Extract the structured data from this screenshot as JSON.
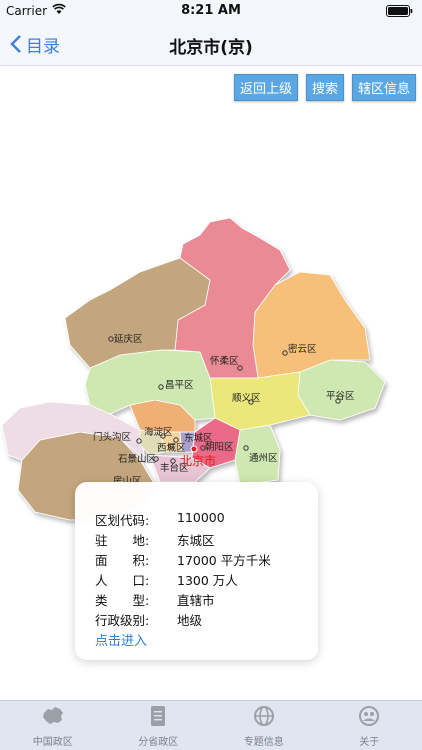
{
  "status": {
    "carrier": "Carrier",
    "time": "8:21 AM"
  },
  "nav": {
    "back_label": "目录",
    "title": "北京市(京)"
  },
  "actions": {
    "up": "返回上级",
    "search": "搜索",
    "info": "辖区信息"
  },
  "map": {
    "districts": {
      "yanqing": "延庆区",
      "huairou": "怀柔区",
      "miyun": "密云区",
      "changping": "昌平区",
      "shunyi": "顺义区",
      "pinggu": "平谷区",
      "mentougou": "门头沟区",
      "haidian": "海淀区",
      "dongcheng": "东城区",
      "xicheng": "西城区",
      "chaoyang": "朝阳区",
      "shijingshan": "石景山区",
      "fengtai": "丰台区",
      "tongzhou": "通州区",
      "fangshan": "房山区"
    },
    "city": "北京市"
  },
  "info": {
    "code_label": "区划代码:",
    "code": "110000",
    "seat_label": "驻　　地:",
    "seat": "东城区",
    "area_label": "面　　积:",
    "area": "17000 平方千米",
    "pop_label": "人　　口:",
    "pop": "1300 万人",
    "type_label": "类　　型:",
    "type": "直辖市",
    "level_label": "行政级别:",
    "level": "地级",
    "enter": "点击进入"
  },
  "tabs": [
    "中国政区",
    "分省政区",
    "专题信息",
    "关于"
  ]
}
